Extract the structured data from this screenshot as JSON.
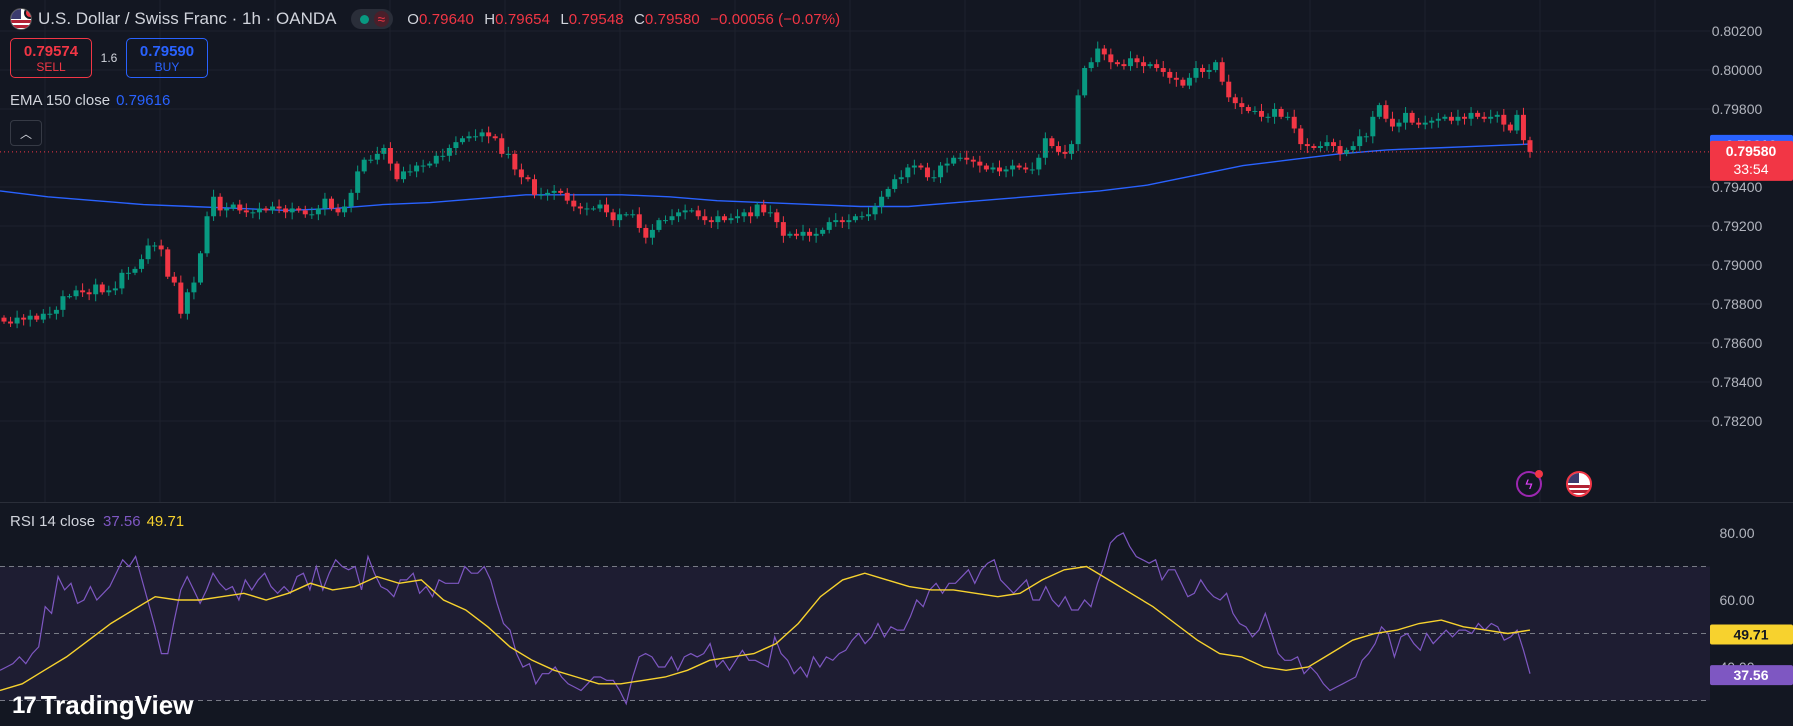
{
  "header": {
    "symbol_title": "U.S. Dollar / Swiss Franc · 1h · OANDA",
    "ohlc": {
      "o_label": "O",
      "o": "0.79640",
      "h_label": "H",
      "h": "0.79654",
      "l_label": "L",
      "l": "0.79548",
      "c_label": "C",
      "c": "0.79580",
      "change": "−0.00056 (−0.07%)"
    }
  },
  "trade": {
    "sell_price": "0.79574",
    "sell_label": "SELL",
    "spread": "1.6",
    "buy_price": "0.79590",
    "buy_label": "BUY"
  },
  "indicators": {
    "ema_label": "EMA 150 close",
    "ema_value": "0.79616",
    "rsi_label": "RSI 14 close",
    "rsi_value": "37.56",
    "rsi_ma_value": "49.71"
  },
  "price_axis": {
    "ticks": [
      "0.80200",
      "0.80000",
      "0.79800",
      "0.79400",
      "0.79200",
      "0.79000",
      "0.78800",
      "0.78600",
      "0.78400",
      "0.78200"
    ],
    "ema_badge": "0.79616",
    "last_badge": "0.79580",
    "countdown": "33:54"
  },
  "rsi_axis": {
    "ticks": [
      "80.00",
      "60.00",
      "40.00"
    ],
    "ma_badge": "49.71",
    "rsi_badge": "37.56"
  },
  "branding": {
    "logo_text": "TradingView",
    "logo_mark": "17"
  },
  "colors": {
    "up": "#089981",
    "down": "#f23645",
    "ema": "#2962ff",
    "rsi": "#7e57c2",
    "rsi_ma": "#f7d22e",
    "background": "#131722"
  },
  "icons": {
    "events": [
      "flash-icon",
      "us-flag-icon"
    ]
  },
  "chart_data": [
    {
      "type": "candlestick",
      "title": "U.S. Dollar / Swiss Franc · 1h · OANDA",
      "ylim": [
        0.7815,
        0.8022
      ],
      "y_ticks": [
        0.802,
        0.8,
        0.798,
        0.794,
        0.792,
        0.79,
        0.788,
        0.786,
        0.784,
        0.782
      ],
      "grid": true,
      "close_series": [
        0.7871,
        0.787,
        0.7873,
        0.7872,
        0.7874,
        0.7872,
        0.7875,
        0.7875,
        0.7877,
        0.7884,
        0.7884,
        0.7887,
        0.7886,
        0.7885,
        0.789,
        0.7886,
        0.7887,
        0.7888,
        0.7896,
        0.7896,
        0.7898,
        0.7903,
        0.791,
        0.791,
        0.7908,
        0.7894,
        0.7891,
        0.7875,
        0.7886,
        0.7891,
        0.7906,
        0.7925,
        0.7935,
        0.7928,
        0.7929,
        0.7931,
        0.7928,
        0.7927,
        0.7927,
        0.7929,
        0.7928,
        0.793,
        0.7929,
        0.7927,
        0.7929,
        0.7928,
        0.7926,
        0.7926,
        0.7929,
        0.7934,
        0.7929,
        0.7927,
        0.793,
        0.7937,
        0.7948,
        0.7954,
        0.7954,
        0.7957,
        0.796,
        0.7952,
        0.7944,
        0.7948,
        0.7948,
        0.7951,
        0.7951,
        0.7952,
        0.7956,
        0.7956,
        0.796,
        0.7963,
        0.7965,
        0.7966,
        0.7966,
        0.7968,
        0.7966,
        0.7965,
        0.7957,
        0.7957,
        0.7949,
        0.7945,
        0.7944,
        0.7936,
        0.7936,
        0.7937,
        0.7938,
        0.7937,
        0.7933,
        0.793,
        0.7929,
        0.7929,
        0.7929,
        0.7931,
        0.7927,
        0.7923,
        0.7926,
        0.7926,
        0.7926,
        0.7919,
        0.7914,
        0.7918,
        0.7923,
        0.7923,
        0.7925,
        0.7927,
        0.7928,
        0.7928,
        0.7925,
        0.7923,
        0.7922,
        0.7925,
        0.7923,
        0.7924,
        0.7925,
        0.7927,
        0.7925,
        0.7931,
        0.7927,
        0.7927,
        0.7922,
        0.7915,
        0.7916,
        0.7915,
        0.7917,
        0.7915,
        0.7916,
        0.7918,
        0.7922,
        0.7923,
        0.7922,
        0.7923,
        0.7925,
        0.7925,
        0.7926,
        0.793,
        0.7935,
        0.7939,
        0.7944,
        0.7945,
        0.795,
        0.7951,
        0.795,
        0.7945,
        0.7945,
        0.7951,
        0.7952,
        0.7955,
        0.7955,
        0.7954,
        0.7953,
        0.7951,
        0.7949,
        0.795,
        0.7948,
        0.7949,
        0.7951,
        0.795,
        0.7949,
        0.7949,
        0.7955,
        0.7965,
        0.7961,
        0.7958,
        0.7957,
        0.7962,
        0.7987,
        0.8001,
        0.8004,
        0.8011,
        0.8008,
        0.8004,
        0.8003,
        0.8002,
        0.8006,
        0.8004,
        0.8002,
        0.8003,
        0.8001,
        0.7999,
        0.7996,
        0.7995,
        0.7992,
        0.7996,
        0.8001,
        0.7999,
        0.8,
        0.8004,
        0.7994,
        0.7986,
        0.7983,
        0.7981,
        0.7979,
        0.7979,
        0.7976,
        0.7976,
        0.798,
        0.7976,
        0.7976,
        0.797,
        0.7962,
        0.7961,
        0.796,
        0.7961,
        0.7963,
        0.7961,
        0.7957,
        0.7959,
        0.7961,
        0.7966,
        0.7966,
        0.7976,
        0.7982,
        0.7975,
        0.7971,
        0.7973,
        0.7978,
        0.7973,
        0.7972,
        0.7973,
        0.7974,
        0.7975,
        0.7976,
        0.7974,
        0.7976,
        0.7975,
        0.7978,
        0.7976,
        0.7975,
        0.7976,
        0.7977,
        0.7972,
        0.7969,
        0.7977,
        0.7964,
        0.7958
      ],
      "ema_150": [
        0.7938,
        0.7935,
        0.7933,
        0.7931,
        0.793,
        0.7929,
        0.7928,
        0.7929,
        0.7931,
        0.7932,
        0.7934,
        0.7936,
        0.7936,
        0.7936,
        0.7935,
        0.7933,
        0.7932,
        0.7931,
        0.793,
        0.793,
        0.7932,
        0.7934,
        0.7936,
        0.7938,
        0.7941,
        0.7946,
        0.7951,
        0.7954,
        0.7957,
        0.7959,
        0.796,
        0.7961,
        0.7962
      ],
      "last": 0.7958,
      "ema_last": 0.79616
    },
    {
      "type": "line",
      "title": "RSI 14 close",
      "ylim": [
        28,
        84
      ],
      "y_ticks": [
        80,
        60,
        40
      ],
      "bands": [
        70,
        50,
        30
      ],
      "series": [
        {
          "name": "RSI 14 close",
          "color": "#7e57c2",
          "values": [
            39,
            40,
            41,
            43,
            41,
            44,
            46,
            58,
            56,
            67,
            63,
            65,
            59,
            60,
            64,
            60,
            62,
            64,
            68,
            72,
            70,
            73,
            66,
            59,
            52,
            44,
            44,
            54,
            63,
            67,
            63,
            59,
            63,
            68,
            65,
            63,
            64,
            60,
            66,
            63,
            66,
            68,
            64,
            62,
            64,
            62,
            67,
            68,
            63,
            70,
            63,
            68,
            72,
            70,
            69,
            70,
            63,
            73,
            68,
            64,
            63,
            61,
            66,
            66,
            68,
            62,
            64,
            61,
            66,
            65,
            65,
            65,
            70,
            68,
            68,
            70,
            66,
            59,
            53,
            51,
            44,
            40,
            41,
            35,
            38,
            38,
            40,
            37,
            35,
            34,
            33,
            35,
            37,
            37,
            36,
            36,
            33,
            29,
            37,
            43,
            44,
            43,
            40,
            40,
            43,
            39,
            43,
            44,
            43,
            44,
            47,
            40,
            42,
            39,
            42,
            45,
            42,
            42,
            41,
            40,
            49,
            44,
            42,
            38,
            40,
            37,
            43,
            40,
            43,
            42,
            44,
            45,
            48,
            50,
            47,
            49,
            53,
            49,
            52,
            51,
            51,
            55,
            60,
            58,
            63,
            65,
            62,
            65,
            65,
            67,
            69,
            65,
            69,
            71,
            72,
            66,
            64,
            62,
            64,
            66,
            60,
            60,
            64,
            60,
            58,
            61,
            57,
            57,
            60,
            58,
            65,
            70,
            77,
            79,
            80,
            76,
            73,
            72,
            71,
            72,
            66,
            69,
            69,
            65,
            61,
            62,
            66,
            63,
            61,
            60,
            62,
            56,
            53,
            52,
            49,
            51,
            56,
            50,
            44,
            42,
            42,
            43,
            38,
            40,
            38,
            35,
            33,
            34,
            35,
            36,
            37,
            42,
            44,
            47,
            52,
            50,
            43,
            49,
            50,
            47,
            45,
            50,
            47,
            49,
            51,
            49,
            51,
            51,
            50,
            53,
            51,
            53,
            52,
            48,
            49,
            51,
            45,
            38
          ]
        },
        {
          "name": "RSI-based MA",
          "color": "#f7d22e",
          "values": [
            33,
            35,
            39,
            43,
            48,
            53,
            57,
            61,
            60,
            60,
            61,
            62,
            60,
            62,
            65,
            63,
            64,
            67,
            65,
            66,
            60,
            57,
            52,
            46,
            42,
            39,
            37,
            35,
            35,
            36,
            37,
            39,
            42,
            43,
            44,
            47,
            53,
            61,
            66,
            68,
            66,
            64,
            63,
            63,
            62,
            61,
            62,
            66,
            69,
            70,
            66,
            62,
            58,
            53,
            48,
            44,
            43,
            40,
            39,
            40,
            44,
            48,
            50,
            51,
            53,
            54,
            52,
            51,
            50,
            51
          ]
        }
      ]
    }
  ]
}
